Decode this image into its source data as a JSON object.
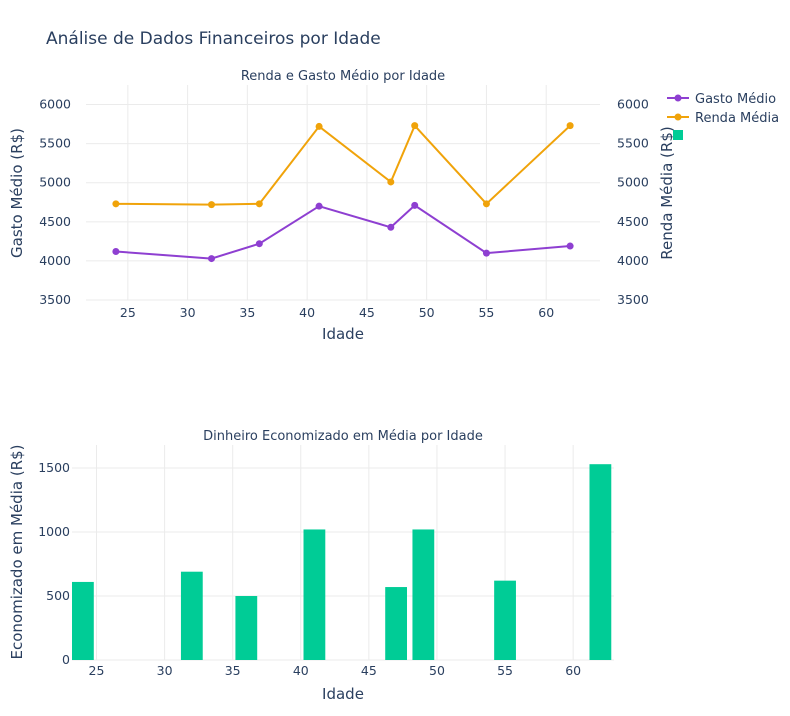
{
  "main_title": "Análise de Dados Financeiros por Idade",
  "colors": {
    "spend": "#8e3fd1",
    "income": "#f0a30a",
    "savings": "#00cc96"
  },
  "legend": [
    "Gasto Médio",
    "Renda Média"
  ],
  "chart_data": [
    {
      "type": "line",
      "title": "Renda e Gasto Médio por Idade",
      "xlabel": "Idade",
      "ylabel": "Gasto Médio (R$)",
      "y2label": "Renda Média (R$)",
      "x": [
        24,
        32,
        36,
        41,
        47,
        49,
        55,
        62
      ],
      "xlim": [
        21.5,
        64.5
      ],
      "ylim": [
        3500,
        6250
      ],
      "xticks": [
        25,
        30,
        35,
        40,
        45,
        50,
        55,
        60
      ],
      "yticks": [
        3500,
        4000,
        4500,
        5000,
        5500,
        6000
      ],
      "series": [
        {
          "name": "Gasto Médio",
          "axis": "left",
          "color": "#8e3fd1",
          "values": [
            4120,
            4030,
            4220,
            4700,
            4430,
            4710,
            4100,
            4190
          ]
        },
        {
          "name": "Renda Média",
          "axis": "right",
          "color": "#f0a30a",
          "values": [
            4730,
            4720,
            4730,
            5720,
            5010,
            5730,
            4730,
            5730
          ]
        }
      ]
    },
    {
      "type": "bar",
      "title": "Dinheiro Economizado em Média por Idade",
      "xlabel": "Idade",
      "ylabel": "Economizado em Média (R$)",
      "x": [
        24,
        32,
        36,
        41,
        47,
        49,
        55,
        62
      ],
      "values": [
        610,
        690,
        500,
        1020,
        570,
        1020,
        620,
        1530
      ],
      "xlim": [
        23.2,
        63
      ],
      "ylim": [
        0,
        1680
      ],
      "xticks": [
        25,
        30,
        35,
        40,
        45,
        50,
        55,
        60
      ],
      "yticks": [
        0,
        500,
        1000,
        1500
      ],
      "color": "#00cc96"
    }
  ]
}
